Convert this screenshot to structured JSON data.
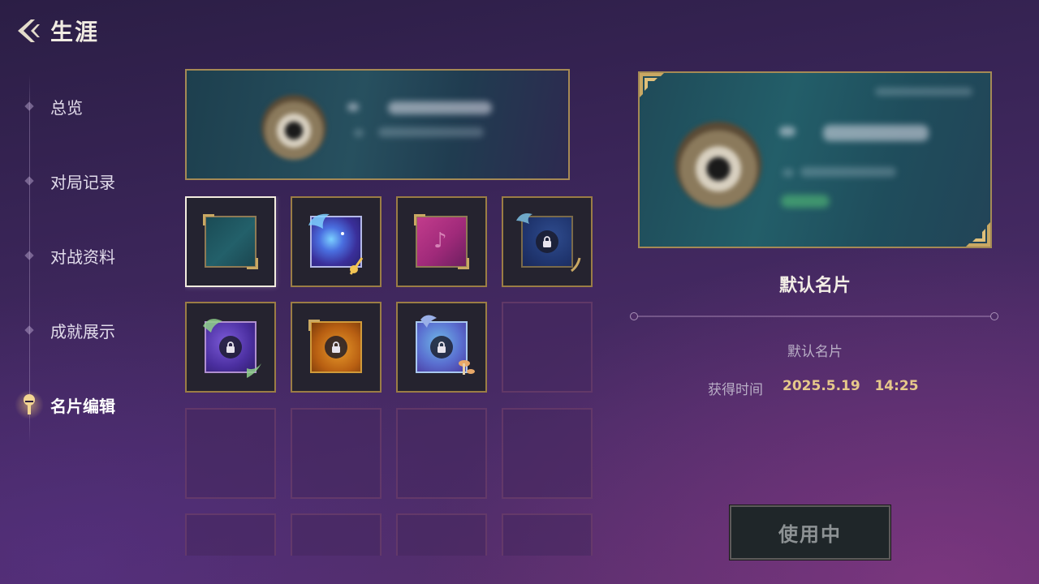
{
  "header": {
    "title": "生涯"
  },
  "nav": {
    "items": [
      {
        "label": "总览",
        "active": false
      },
      {
        "label": "对局记录",
        "active": false
      },
      {
        "label": "对战资料",
        "active": false
      },
      {
        "label": "成就展示",
        "active": false
      },
      {
        "label": "名片编辑",
        "active": true
      }
    ]
  },
  "grid": {
    "cells": [
      {
        "theme": "teal",
        "state": "selected",
        "locked": false
      },
      {
        "theme": "galaxy",
        "state": "owned",
        "locked": false
      },
      {
        "theme": "pink",
        "state": "owned",
        "locked": false
      },
      {
        "theme": "navy",
        "state": "locked",
        "locked": true
      },
      {
        "theme": "purple",
        "state": "locked",
        "locked": true
      },
      {
        "theme": "amber",
        "state": "locked",
        "locked": true
      },
      {
        "theme": "sky",
        "state": "locked",
        "locked": true
      },
      {
        "state": "empty"
      }
    ]
  },
  "detail": {
    "card_name": "默认名片",
    "card_desc": "默认名片",
    "obtain_label": "获得时间",
    "obtain_value": "2025.5.19   14:25",
    "use_button_label": "使用中"
  },
  "colors": {
    "gold_border": "#a58a55",
    "accent_gold_text": "#e6c88a",
    "selected_border": "#f3ecdf"
  }
}
